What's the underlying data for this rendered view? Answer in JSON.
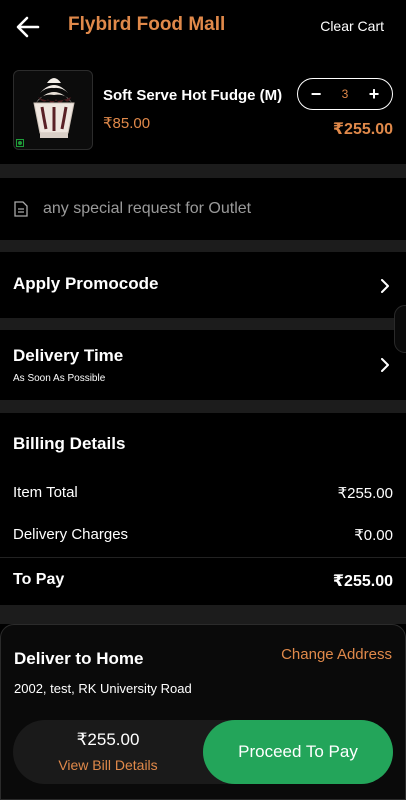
{
  "header": {
    "title": "Flybird Food Mall",
    "clear_cart": "Clear Cart"
  },
  "cart": {
    "item_name": "Soft Serve Hot Fudge (M)",
    "unit_price": "₹85.00",
    "quantity": "3",
    "line_total": "₹255.00"
  },
  "special_request": {
    "placeholder": "any special request for Outlet"
  },
  "promocode": {
    "label": "Apply Promocode"
  },
  "delivery_time": {
    "label": "Delivery Time",
    "value": "As Soon As Possible"
  },
  "billing": {
    "title": "Billing Details",
    "item_total_label": "Item Total",
    "item_total_value": "₹255.00",
    "delivery_label": "Delivery Charges",
    "delivery_value": "₹0.00",
    "to_pay_label": "To Pay",
    "to_pay_value": "₹255.00"
  },
  "delivery": {
    "title": "Deliver to Home",
    "change_address": "Change Address",
    "address": "2002, test, RK University Road"
  },
  "bottom_bar": {
    "total": "₹255.00",
    "view_bill": "View Bill Details",
    "proceed": "Proceed To Pay"
  },
  "colors": {
    "accent": "#e0894a",
    "proceed_green": "#23a55a",
    "background": "#000000",
    "separator": "#1c1c1c"
  }
}
